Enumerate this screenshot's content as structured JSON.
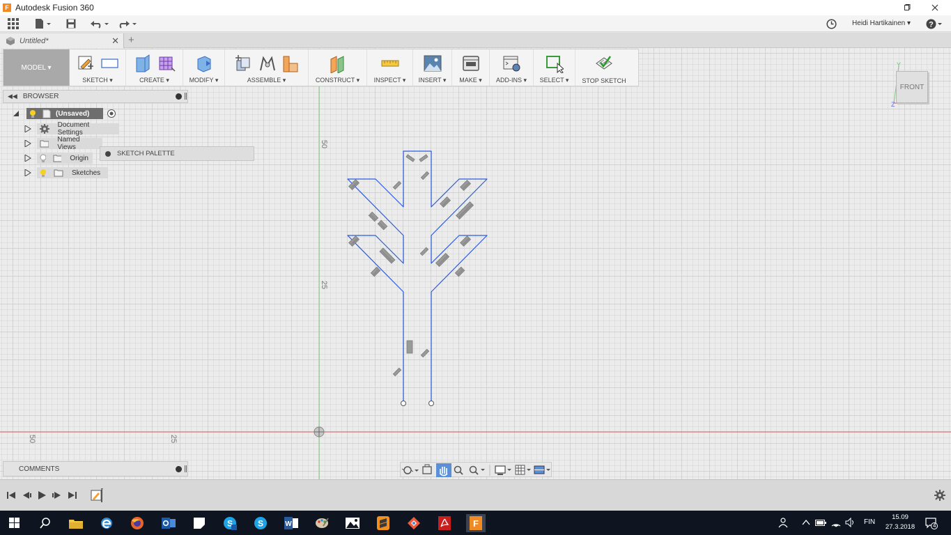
{
  "window": {
    "title": "Autodesk Fusion 360",
    "app_icon": "F",
    "user": "Heidi Hartikainen ▾"
  },
  "tab": {
    "title": "Untitled*",
    "close": "✕",
    "new_tab": "+"
  },
  "toolbar": {
    "workspace": "MODEL ▾",
    "groups": [
      {
        "label": "SKETCH ▾"
      },
      {
        "label": "CREATE ▾"
      },
      {
        "label": "MODIFY ▾"
      },
      {
        "label": "ASSEMBLE ▾"
      },
      {
        "label": "CONSTRUCT ▾"
      },
      {
        "label": "INSPECT ▾"
      },
      {
        "label": "INSERT ▾"
      },
      {
        "label": "MAKE ▾"
      },
      {
        "label": "ADD-INS ▾"
      },
      {
        "label": "SELECT ▾"
      },
      {
        "label": "STOP SKETCH"
      }
    ]
  },
  "browser": {
    "title": "BROWSER",
    "root": "(Unsaved)",
    "items": [
      {
        "label": "Document Settings",
        "icon": "gear-icon"
      },
      {
        "label": "Named Views",
        "icon": "folder-icon"
      },
      {
        "label": "Origin",
        "icon": "folder-icon"
      },
      {
        "label": "Sketches",
        "icon": "folder-icon"
      }
    ]
  },
  "sketch_palette": {
    "title": "SKETCH PALETTE"
  },
  "comments": {
    "title": "COMMENTS"
  },
  "viewcube": {
    "face": "FRONT",
    "axis_y": "Y",
    "axis_z": "Z"
  },
  "ruler": {
    "v_top": "50",
    "v_mid": "25",
    "h_left": "50",
    "h_mid": "25"
  },
  "taskbar": {
    "language": "FIN",
    "time": "15.09",
    "date": "27.3.2018",
    "notifications": "4"
  },
  "colors": {
    "sketch_line": "#2b5bdc",
    "x_axis": "#d45a5a",
    "y_axis": "#7cc97c",
    "taskbar": "#0e1520",
    "workspace": "#a9a9a9"
  }
}
